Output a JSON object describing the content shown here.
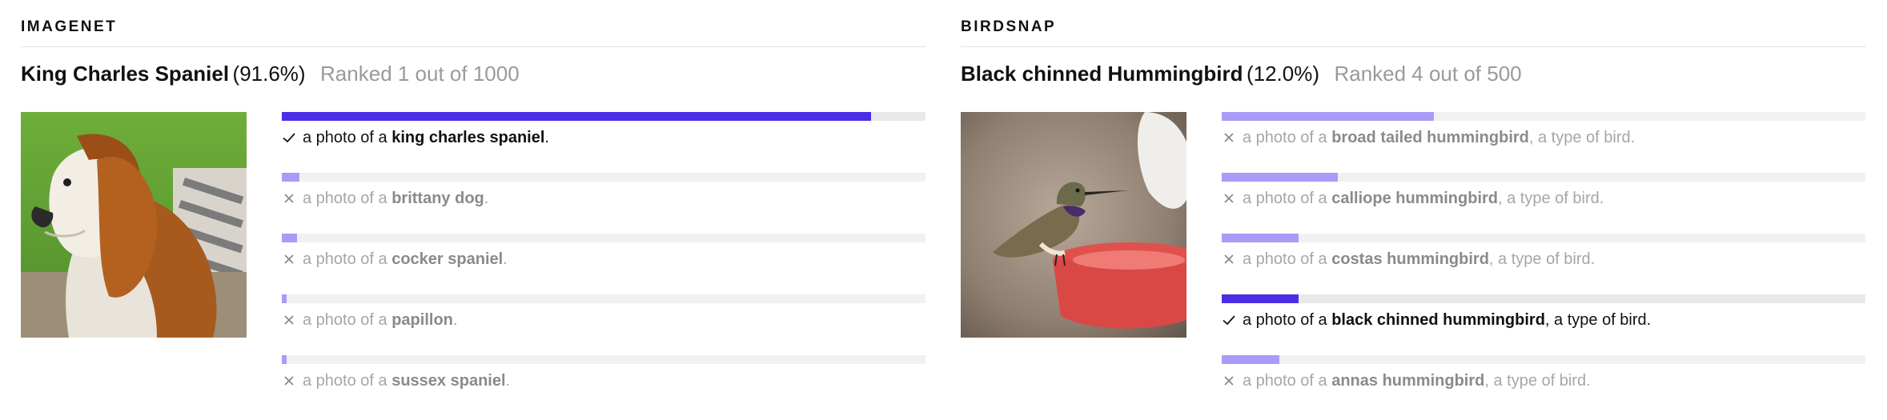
{
  "panels": [
    {
      "dataset": "IMAGENET",
      "top_class": "King Charles Spaniel",
      "top_prob": "(91.6%)",
      "rank": "Ranked 1 out of 1000",
      "image": "King Charles Spaniel dog photo",
      "predictions": [
        {
          "prefix": "a photo of a",
          "label": "king charles spaniel",
          "suffix": ".",
          "prob": 0.916,
          "correct": true
        },
        {
          "prefix": "a photo of a",
          "label": "brittany dog",
          "suffix": ".",
          "prob": 0.027,
          "correct": false
        },
        {
          "prefix": "a photo of a",
          "label": "cocker spaniel",
          "suffix": ".",
          "prob": 0.024,
          "correct": false
        },
        {
          "prefix": "a photo of a",
          "label": "papillon",
          "suffix": ".",
          "prob": 0.007,
          "correct": false
        },
        {
          "prefix": "a photo of a",
          "label": "sussex spaniel",
          "suffix": ".",
          "prob": 0.007,
          "correct": false
        }
      ]
    },
    {
      "dataset": "BIRDSNAP",
      "top_class": "Black chinned Hummingbird",
      "top_prob": "(12.0%)",
      "rank": "Ranked 4 out of 500",
      "image": "Hummingbird at a red feeder photo",
      "predictions": [
        {
          "prefix": "a photo of a",
          "label": "broad tailed hummingbird",
          "suffix": ", a type of bird.",
          "prob": 0.33,
          "correct": false
        },
        {
          "prefix": "a photo of a",
          "label": "calliope hummingbird",
          "suffix": ", a type of bird.",
          "prob": 0.18,
          "correct": false
        },
        {
          "prefix": "a photo of a",
          "label": "costas hummingbird",
          "suffix": ", a type of bird.",
          "prob": 0.12,
          "correct": false
        },
        {
          "prefix": "a photo of a",
          "label": "black chinned hummingbird",
          "suffix": ", a type of bird.",
          "prob": 0.12,
          "correct": true
        },
        {
          "prefix": "a photo of a",
          "label": "annas hummingbird",
          "suffix": ", a type of bird.",
          "prob": 0.09,
          "correct": false
        }
      ]
    }
  ],
  "colors": {
    "correct_bar": "#4a2ee6",
    "other_bar": "#a99bf7",
    "track": "#f1f1f1",
    "muted_text": "#a6a6a6"
  },
  "icons": {
    "correct": "check-icon",
    "incorrect": "cross-icon"
  }
}
